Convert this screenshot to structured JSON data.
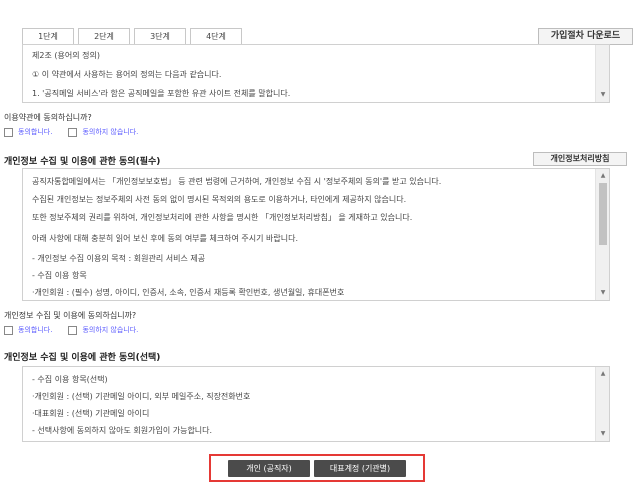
{
  "tabs": [
    "1단계",
    "2단계",
    "3단계",
    "4단계"
  ],
  "download_label": "가입절차 다운로드",
  "terms": {
    "lines": [
      "제2조 (용어의 정의)",
      "① 이 약관에서 사용하는 용어의 정의는 다음과 같습니다.",
      "1. '공직메일 서비스'라 함은 공직메일을 포함한 유관 사이트 전체를 말합니다."
    ],
    "question": "이용약관에 동의하십니까?",
    "agree": "동의합니다.",
    "disagree": "동의하지 않습니다."
  },
  "required": {
    "title": "개인정보 수집 및 이용에 관한 동의(필수)",
    "policy_label": "개인정보처리방침",
    "lines": [
      "공직자통합메일에서는 「개인정보보호법」 등 관련 법령에 근거하여, 개인정보 수집 시 '정보주체의 동의'를 받고 있습니다.",
      "수집된 개인정보는 정보주체의 사전 동의 없이 명시된 목적외의 용도로 이용하거나, 타인에게 제공하지 않습니다.",
      "또한 정보주체의 권리를 위하여, 개인정보처리에 관한 사항을 명시한 「개인정보처리방침」 을 게재하고 있습니다.",
      "아래 사항에 대해 충분히 읽어 보신 후에 동의 여부를 체크하여 주시기 바랍니다.",
      "- 개인정보 수집 이용의 목적 : 회원관리 서비스 제공",
      "- 수집 이용 항목",
      "·개인회원 : (필수) 성명, 아이디, 인증서, 소속, 인증서 재등록 확인번호, 생년월일, 휴대폰번호"
    ],
    "question": "개인정보 수집 및 이용에 동의하십니까?",
    "agree": "동의합니다.",
    "disagree": "동의하지 않습니다."
  },
  "optional": {
    "title": "개인정보 수집 및 이용에 관한 동의(선택)",
    "lines": [
      "- 수집 이용 항목(선택)",
      "·개인회원 : (선택) 기관메일 아이디, 외부 메일주소, 직장전화번호",
      "·대표회원 : (선택) 기관메일 아이디",
      "- 선택사항에 동의하지 않아도 회원가입이 가능합니다."
    ]
  },
  "buttons": {
    "individual": "개인 (공직자)",
    "representative": "대표계정 (기관별)"
  },
  "colors": {
    "highlight": "#e53935",
    "button_bg": "#4b4b4b",
    "link": "#5a5aff"
  }
}
